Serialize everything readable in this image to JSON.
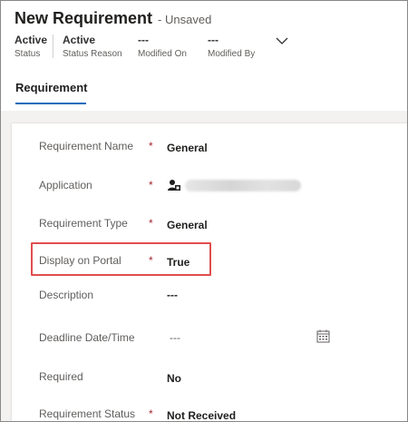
{
  "header": {
    "title": "New Requirement",
    "subtitle": "- Unsaved",
    "fields": [
      {
        "value": "Active",
        "label": "Status"
      },
      {
        "value": "Active",
        "label": "Status Reason"
      },
      {
        "value": "---",
        "label": "Modified On"
      },
      {
        "value": "---",
        "label": "Modified By"
      }
    ]
  },
  "tabs": [
    {
      "label": "Requirement",
      "active": true
    }
  ],
  "form": {
    "rows": [
      {
        "label": "Requirement Name",
        "required": true,
        "value": "General"
      },
      {
        "label": "Application",
        "required": true,
        "value": ""
      },
      {
        "label": "Requirement Type",
        "required": true,
        "value": "General"
      },
      {
        "label": "Display on Portal",
        "required": true,
        "value": "True"
      },
      {
        "label": "Description",
        "required": false,
        "value": "---"
      },
      {
        "label": "Deadline Date/Time",
        "required": false,
        "value": "---"
      },
      {
        "label": "Required",
        "required": false,
        "value": "No"
      },
      {
        "label": "Requirement Status",
        "required": true,
        "value": "Not Received"
      }
    ],
    "required_marker": "*"
  },
  "icons": {
    "expand": "chevron-down-icon",
    "lookup": "contact-lookup-icon",
    "calendar": "calendar-icon"
  },
  "colors": {
    "accent": "#0f6cbd",
    "required": "#a4262c",
    "highlight": "#e04e4e"
  }
}
